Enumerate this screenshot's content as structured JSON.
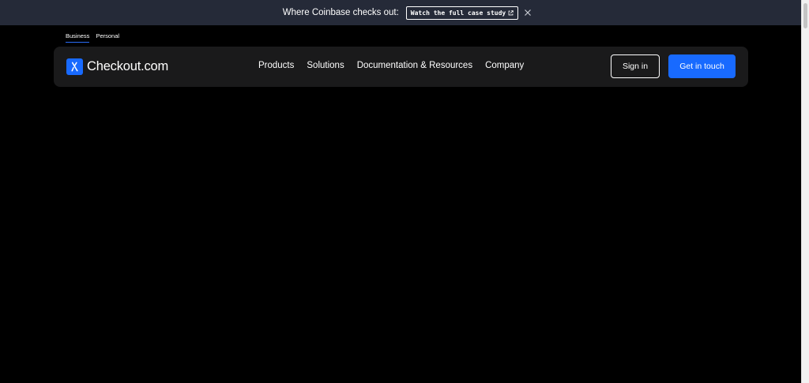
{
  "announcement": {
    "text": "Where Coinbase checks out:",
    "cta_label": "Watch the full case study",
    "cta_icon": "external-link-icon",
    "close_icon": "close-icon"
  },
  "audience": {
    "tabs": [
      {
        "label": "Business",
        "active": true
      },
      {
        "label": "Personal",
        "active": false
      }
    ]
  },
  "nav": {
    "logo_text": "Checkout.com",
    "logo_icon": "checkout-logo-icon",
    "links": [
      "Products",
      "Solutions",
      "Documentation & Resources",
      "Company"
    ],
    "sign_in_label": "Sign in",
    "get_in_touch_label": "Get in touch"
  },
  "colors": {
    "background": "#000000",
    "announcement_bg": "#252a38",
    "navbar_bg": "#1a1a1b",
    "accent": "#186aff",
    "text": "#ffffff"
  }
}
